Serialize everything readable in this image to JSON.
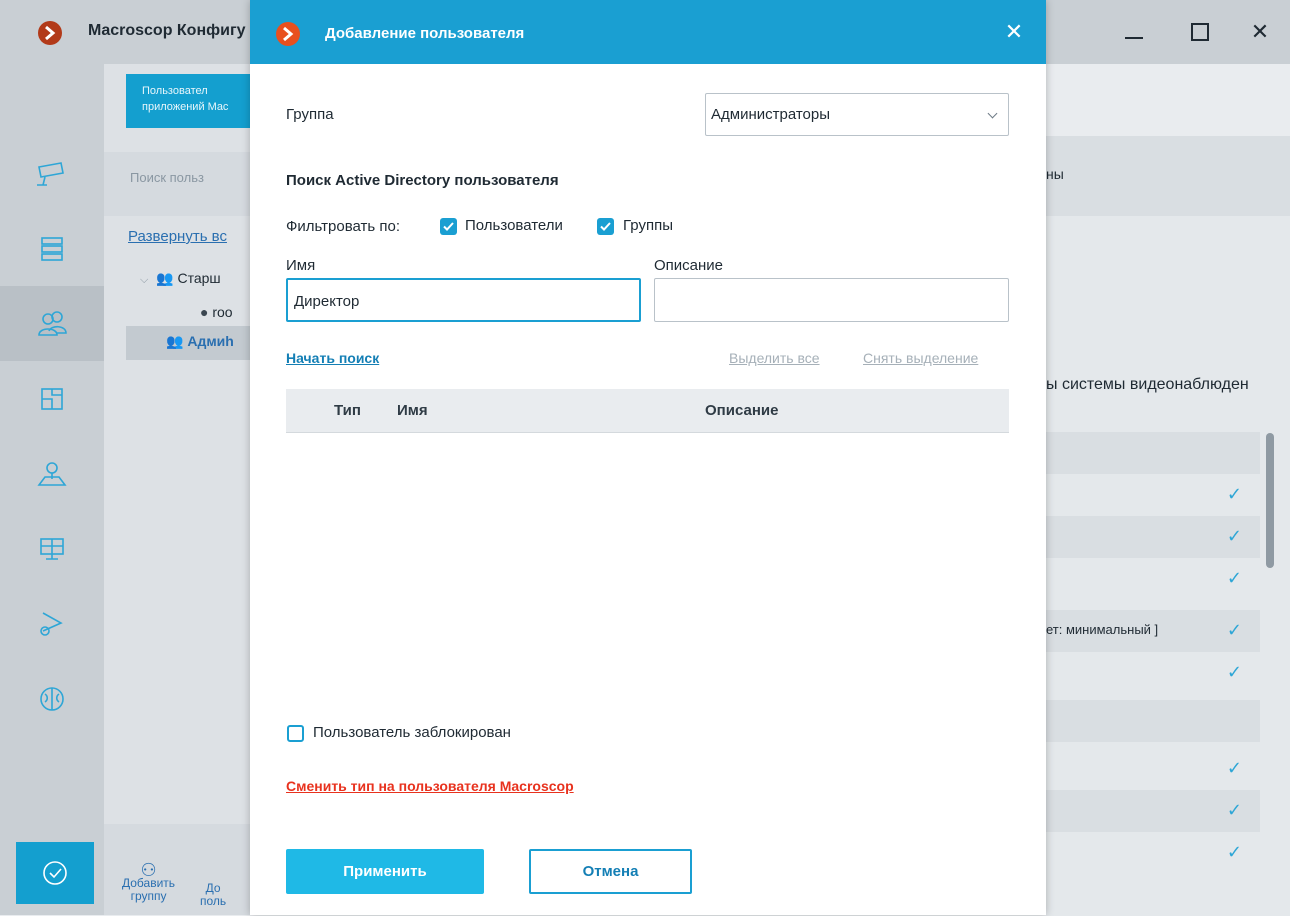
{
  "window": {
    "title": "Macroscop Конфигу",
    "controls": {
      "minimize_icon": "minimize-icon",
      "maximize_icon": "maximize-icon",
      "close_label": "✕"
    }
  },
  "sidebar": {
    "items": [
      {
        "icon": "camera-icon"
      },
      {
        "icon": "server-icon"
      },
      {
        "icon": "users-icon",
        "active": true
      },
      {
        "icon": "layout-icon"
      },
      {
        "icon": "map-icon"
      },
      {
        "icon": "monitor-icon"
      },
      {
        "icon": "automation-icon"
      },
      {
        "icon": "brain-icon"
      }
    ],
    "bottom_icon": "check-circle-icon"
  },
  "left_panel": {
    "tab_line1": "Пользовател",
    "tab_line2": "приложений Mac",
    "search_placeholder": "Поиск польз",
    "expand_link": "Развернуть вс",
    "tree": {
      "group1": "Старш",
      "user1": "roo",
      "group2": "Адмиh"
    },
    "add_group_line1": "Добавить",
    "add_group_line2": "группу",
    "add_user_line1": "До",
    "add_user_line2": "поль"
  },
  "right_panel": {
    "header_text": "ны",
    "caption": "ы системы видеонаблюден",
    "row_text": "ет: минимальный ]"
  },
  "dialog": {
    "title": "Добавление пользователя",
    "close_label": "✕",
    "group_label": "Группа",
    "group_value": "Администраторы",
    "search_heading": "Поиск Active Directory пользователя",
    "filter_label": "Фильтровать по:",
    "filter_users": "Пользователи",
    "filter_groups": "Группы",
    "name_label": "Имя",
    "name_value": "Директор",
    "description_label": "Описание",
    "description_value": "",
    "start_search": "Начать поиск",
    "select_all": "Выделить все",
    "deselect": "Снять выделение",
    "table_headers": {
      "type": "Тип",
      "name": "Имя",
      "description": "Описание"
    },
    "blocked_label": "Пользователь заблокирован",
    "change_type_link": "Сменить тип на пользователя Macroscop",
    "apply_label": "Применить",
    "cancel_label": "Отмена"
  },
  "colors": {
    "accent": "#1a9fd2",
    "danger_link": "#e8321e",
    "logo": "#e8501e"
  }
}
